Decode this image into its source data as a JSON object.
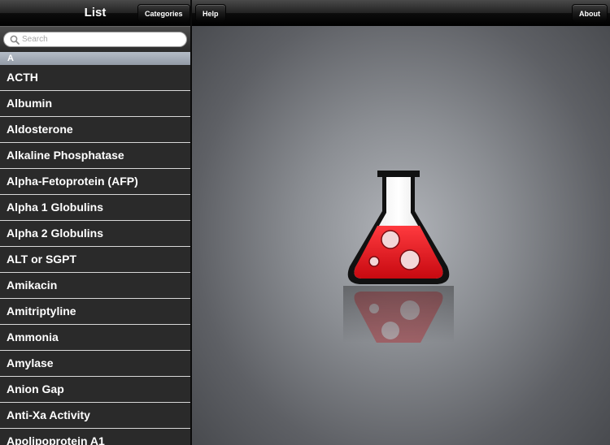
{
  "master": {
    "title": "List",
    "categories_label": "Categories",
    "search": {
      "placeholder": "Search",
      "icon": "search-icon"
    },
    "section_letter": "A",
    "items": [
      "ACTH",
      "Albumin",
      "Aldosterone",
      "Alkaline Phosphatase",
      "Alpha-Fetoprotein (AFP)",
      "Alpha 1 Globulins",
      "Alpha 2 Globulins",
      "ALT or SGPT",
      "Amikacin",
      "Amitriptyline",
      "Ammonia",
      "Amylase",
      "Anion Gap",
      "Anti-Xa Activity",
      "Apolipoprotein A1"
    ]
  },
  "detail": {
    "help_label": "Help",
    "about_label": "About",
    "logo_icon": "lab-flask-icon"
  },
  "colors": {
    "flask_liquid": "#e8141c",
    "list_background": "#2b2b2b",
    "section_header": "#a3abb5"
  }
}
